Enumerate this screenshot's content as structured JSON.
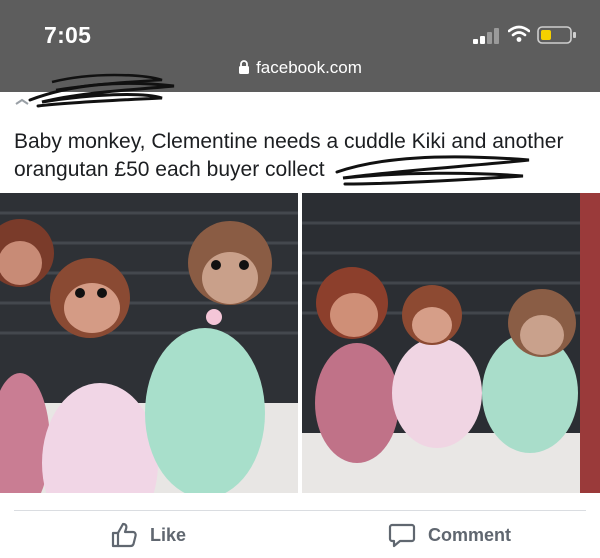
{
  "status_bar": {
    "time": "7:05"
  },
  "browser": {
    "url": "facebook.com"
  },
  "post": {
    "text": "Baby monkey, Clementine needs a cuddle Kiki and another orangutan £50 each buyer collect"
  },
  "actions": {
    "like_label": "Like",
    "comment_label": "Comment"
  },
  "icons": [
    "lock-icon",
    "signal-icon",
    "wifi-icon",
    "battery-icon",
    "like-icon",
    "comment-icon"
  ],
  "colors": {
    "status_bar_bg": "#5d5d5d",
    "battery_fill": "#f5d000",
    "action_text": "#606770"
  }
}
